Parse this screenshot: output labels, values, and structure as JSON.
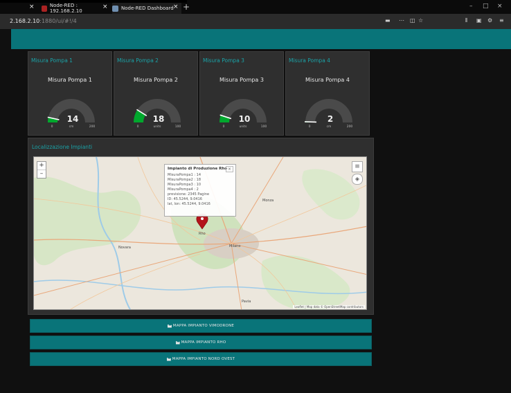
{
  "browser": {
    "tabs": [
      {
        "title": "Node-RED : 192.168.2.10",
        "active": false,
        "favicon_color": "#aa2222"
      },
      {
        "title": "Node-RED Dashboard",
        "active": true,
        "favicon_color": "#6f8fb0"
      }
    ],
    "url_host": "2.168.2.10",
    "url_path": ":1880/ui/#!/4",
    "window_controls": [
      "–",
      "□",
      "×"
    ]
  },
  "gauges": [
    {
      "group": "Misura Pompa 1",
      "label": "Misura Pompa 1",
      "value": "14",
      "level": 0.07,
      "min": "0",
      "unit": "cm",
      "max": "200"
    },
    {
      "group": "Misura Pompa 2",
      "label": "Misura Pompa 2",
      "value": "18",
      "level": 0.18,
      "min": "0",
      "unit": "units",
      "max": "100"
    },
    {
      "group": "Misura Pompa 3",
      "label": "Misura Pompa 3",
      "value": "10",
      "level": 0.1,
      "min": "0",
      "unit": "units",
      "max": "100"
    },
    {
      "group": "Misura Pompa 4",
      "label": "Misura Pompa 4",
      "value": "2",
      "level": 0.01,
      "min": "0",
      "unit": "cm",
      "max": "200"
    }
  ],
  "map": {
    "group_title": "Localizzazione Impianti",
    "zoom_in": "+",
    "zoom_out": "–",
    "popup": {
      "title": "Impianto di Produzione Rho",
      "rows": [
        "MisuraPompa1 : 14",
        "MisuraPompa2 : 18",
        "MisuraPompa3 : 10",
        "MisuraPompa4 : 2",
        "previsione: 2345 Pagine",
        "ID: 45.5244, 9.0416",
        "lat, lon: 45.5244, 9.0416"
      ],
      "close": "×"
    },
    "cities": [
      "Rho",
      "Milano",
      "Novara",
      "Monza",
      "Pavia"
    ],
    "attribution": "Leaflet | Map data © OpenStreetMap contributors"
  },
  "buttons": [
    {
      "label": "MAPPA IMPIANTO VIMODRONE"
    },
    {
      "label": "MAPPA IMPIANTO RHO"
    },
    {
      "label": "MAPPA IMPIANTO NORD OVEST"
    }
  ],
  "colors": {
    "accent": "#097479",
    "gauge_fill": "#00a82d",
    "group_title": "#1aa3a8"
  }
}
